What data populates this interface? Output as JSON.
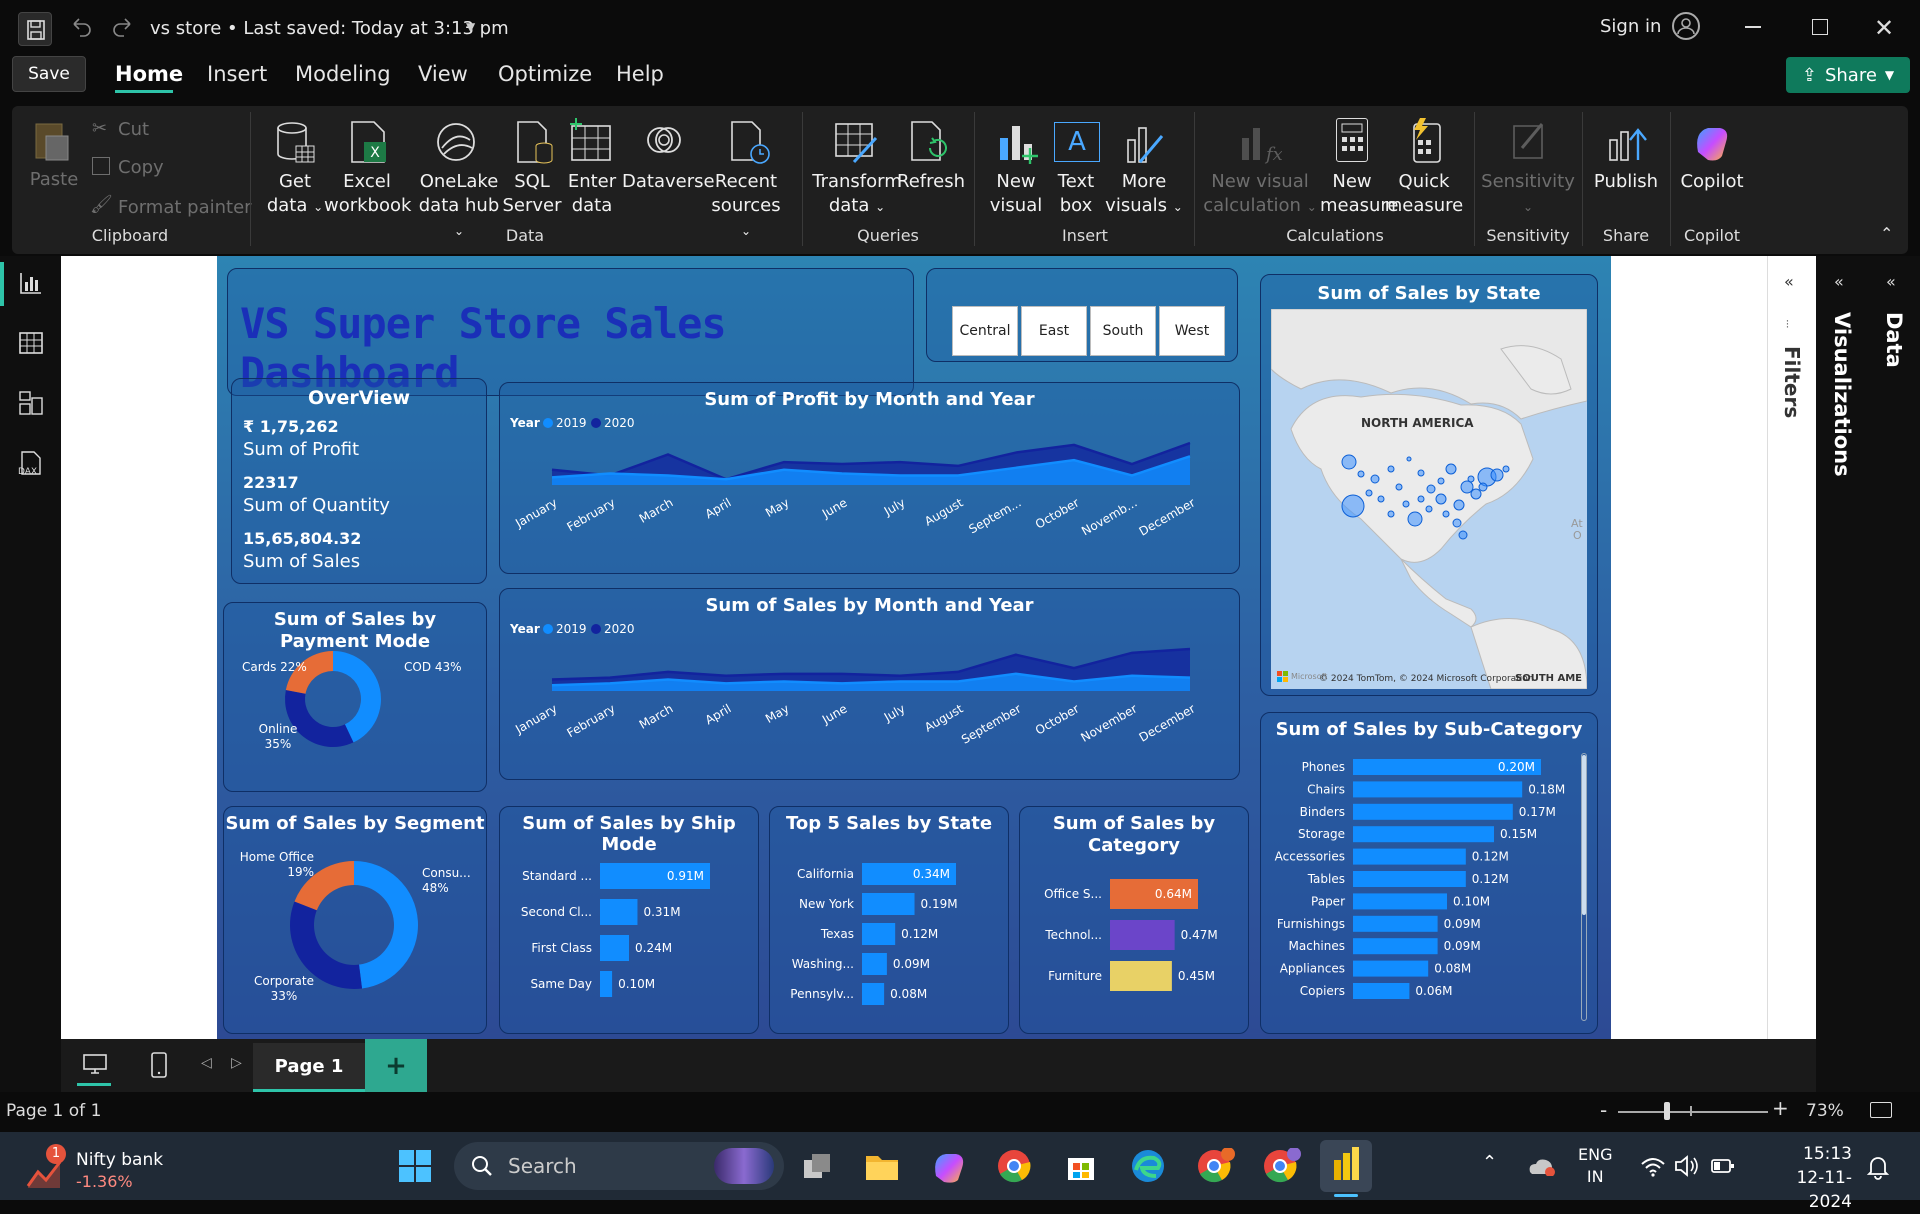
{
  "titlebar": {
    "doc_name": "vs store",
    "saved": "Last saved: Today at 3:13 pm",
    "sign_in": "Sign in",
    "save_tooltip": "Save"
  },
  "tabs": [
    "Home",
    "Insert",
    "Modeling",
    "View",
    "Optimize",
    "Help"
  ],
  "share_label": "Share",
  "ribbon": {
    "clipboard": {
      "paste": "Paste",
      "cut": "Cut",
      "copy": "Copy",
      "format_painter": "Format painter",
      "group": "Clipboard"
    },
    "data": {
      "get_data_1": "Get",
      "get_data_2": "data",
      "excel_1": "Excel",
      "excel_2": "workbook",
      "onelake_1": "OneLake",
      "onelake_2": "data hub",
      "sql_1": "SQL",
      "sql_2": "Server",
      "enter_1": "Enter",
      "enter_2": "data",
      "dataverse": "Dataverse",
      "recent_1": "Recent",
      "recent_2": "sources",
      "group": "Data"
    },
    "queries": {
      "transform_1": "Transform",
      "transform_2": "data",
      "refresh": "Refresh",
      "group": "Queries"
    },
    "insert": {
      "new_visual_1": "New",
      "new_visual_2": "visual",
      "text_box_1": "Text",
      "text_box_2": "box",
      "more_1": "More",
      "more_2": "visuals",
      "group": "Insert"
    },
    "calculations": {
      "new_visual_calc_1": "New visual",
      "new_visual_calc_2": "calculation",
      "new_measure_1": "New",
      "new_measure_2": "measure",
      "quick_measure_1": "Quick",
      "quick_measure_2": "measure",
      "group": "Calculations"
    },
    "sensitivity": {
      "label": "Sensitivity",
      "group": "Sensitivity"
    },
    "share": {
      "publish": "Publish",
      "group": "Share"
    },
    "copilot": {
      "label": "Copilot",
      "group": "Copilot"
    }
  },
  "report": {
    "title": "VS Super Store Sales Dashboard",
    "slicer": [
      "Central",
      "East",
      "South",
      "West"
    ],
    "overview": {
      "title": "OverView",
      "profit_value": "₹ 1,75,262",
      "profit_label": "Sum of Profit",
      "quantity_value": "22317",
      "quantity_label": "Sum of Quantity",
      "sales_value": "15,65,804.32",
      "sales_label": "Sum of Sales"
    },
    "map": {
      "title": "Sum of Sales by State",
      "region_label": "NORTH AMERICA",
      "attribution": "© 2024 TomTom, © 2024 Microsoft Corporation",
      "south_label": "SOUTH AME",
      "ms_label": "Microsoft",
      "atlantic": "At",
      "atlantic2": "O"
    }
  },
  "chart_data": [
    {
      "type": "area",
      "title": "Sum of Profit by Month and Year",
      "legend_title": "Year",
      "categories": [
        "January",
        "February",
        "March",
        "April",
        "May",
        "June",
        "July",
        "August",
        "Septem...",
        "October",
        "Novemb...",
        "December"
      ],
      "series": [
        {
          "name": "2019",
          "color": "#118dff",
          "values": [
            4,
            6,
            5,
            3,
            8,
            6,
            5,
            5,
            9,
            13,
            5,
            15
          ]
        },
        {
          "name": "2020",
          "color": "#12239e",
          "values": [
            8,
            5,
            16,
            3,
            12,
            11,
            12,
            10,
            17,
            21,
            11,
            22
          ]
        }
      ]
    },
    {
      "type": "area",
      "title": "Sum of Sales by Month and Year",
      "legend_title": "Year",
      "categories": [
        "January",
        "February",
        "March",
        "April",
        "May",
        "June",
        "July",
        "August",
        "September",
        "October",
        "November",
        "December"
      ],
      "series": [
        {
          "name": "2019",
          "color": "#118dff",
          "values": [
            3,
            4,
            6,
            4,
            5,
            4,
            5,
            5,
            9,
            5,
            8,
            7
          ]
        },
        {
          "name": "2020",
          "color": "#12239e",
          "values": [
            6,
            7,
            10,
            8,
            9,
            9,
            8,
            10,
            19,
            12,
            20,
            22
          ]
        }
      ]
    },
    {
      "type": "pie",
      "title": "Sum of Sales by Payment Mode",
      "slices": [
        {
          "label": "COD",
          "value": 43,
          "display": "COD 43%",
          "color": "#118dff"
        },
        {
          "label": "Online",
          "value": 35,
          "display": "Online 35%",
          "color": "#12239e"
        },
        {
          "label": "Cards",
          "value": 22,
          "display": "Cards 22%",
          "color": "#e66c37"
        }
      ]
    },
    {
      "type": "pie",
      "title": "Sum of Sales by Segment",
      "slices": [
        {
          "label": "Consu...",
          "value": 48,
          "display": "48%",
          "color": "#118dff"
        },
        {
          "label": "Corporate",
          "value": 33,
          "display": "33%",
          "color": "#12239e"
        },
        {
          "label": "Home Office",
          "value": 19,
          "display": "19%",
          "color": "#e66c37"
        }
      ]
    },
    {
      "type": "bar",
      "title": "Sum of Sales by Ship Mode",
      "categories": [
        "Standard ...",
        "Second Cl...",
        "First Class",
        "Same Day"
      ],
      "values": [
        0.91,
        0.31,
        0.24,
        0.1
      ],
      "labels": [
        "0.91M",
        "0.31M",
        "0.24M",
        "0.10M"
      ],
      "color": "#118dff"
    },
    {
      "type": "bar",
      "title": "Top 5 Sales by State",
      "categories": [
        "California",
        "New York",
        "Texas",
        "Washing...",
        "Pennsylv..."
      ],
      "values": [
        0.34,
        0.19,
        0.12,
        0.09,
        0.08
      ],
      "labels": [
        "0.34M",
        "0.19M",
        "0.12M",
        "0.09M",
        "0.08M"
      ],
      "color": "#118dff"
    },
    {
      "type": "bar",
      "title": "Sum of Sales by Category",
      "categories": [
        "Office S...",
        "Technol...",
        "Furniture"
      ],
      "values": [
        0.64,
        0.47,
        0.45
      ],
      "labels": [
        "0.64M",
        "0.47M",
        "0.45M"
      ],
      "colors": [
        "#e66c37",
        "#6b45c9",
        "#e8d166"
      ]
    },
    {
      "type": "bar",
      "title": "Sum of Sales by Sub-Category",
      "categories": [
        "Phones",
        "Chairs",
        "Binders",
        "Storage",
        "Accessories",
        "Tables",
        "Paper",
        "Furnishings",
        "Machines",
        "Appliances",
        "Copiers"
      ],
      "values": [
        0.2,
        0.18,
        0.17,
        0.15,
        0.12,
        0.12,
        0.1,
        0.09,
        0.09,
        0.08,
        0.06
      ],
      "labels": [
        "0.20M",
        "0.18M",
        "0.17M",
        "0.15M",
        "0.12M",
        "0.12M",
        "0.10M",
        "0.09M",
        "0.09M",
        "0.08M",
        "0.06M"
      ],
      "color": "#118dff"
    }
  ],
  "panes": {
    "filters": "Filters",
    "visualizations": "Visualizations",
    "data": "Data"
  },
  "pages": {
    "current": "Page 1",
    "status": "Page 1 of 1",
    "zoom": "73%"
  },
  "taskbar": {
    "widget_title": "Nifty bank",
    "widget_value": "-1.36%",
    "widget_badge": "1",
    "search": "Search",
    "lang_1": "ENG",
    "lang_2": "IN",
    "time": "15:13",
    "date": "12-11-2024"
  },
  "colors": {
    "accent": "#118dff",
    "dark_series": "#12239e",
    "report_title": "#1a2fb8",
    "share_green": "#0f7a5c"
  }
}
